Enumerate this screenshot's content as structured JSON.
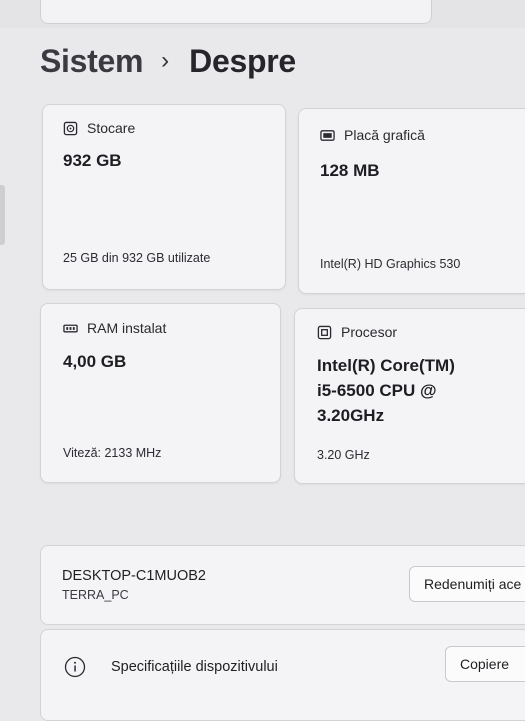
{
  "breadcrumb": {
    "parent": "Sistem",
    "separator": "›",
    "current": "Despre"
  },
  "cards": {
    "storage": {
      "title": "Stocare",
      "value": "932 GB",
      "footer": "25 GB din 932 GB utilizate",
      "icon": "storage-drive-icon"
    },
    "gpu": {
      "title": "Placă grafică",
      "value": "128 MB",
      "footer": "Intel(R) HD Graphics 530",
      "icon": "display-adapter-icon"
    },
    "ram": {
      "title": "RAM instalat",
      "value": "4,00 GB",
      "footer": "Viteză: 2133 MHz",
      "icon": "memory-module-icon"
    },
    "cpu": {
      "title": "Procesor",
      "value_lines": [
        "Intel(R) Core(TM)",
        "i5-6500 CPU @",
        "3.20GHz"
      ],
      "footer": "3.20 GHz",
      "icon": "processor-chip-icon"
    }
  },
  "device": {
    "name": "DESKTOP-C1MUOB2",
    "subtitle": "TERRA_PC",
    "rename_label": "Redenumiți ace"
  },
  "specs": {
    "label": "Specificațiile dispozitivului",
    "copy_label": "Copiere",
    "icon": "info-icon"
  }
}
